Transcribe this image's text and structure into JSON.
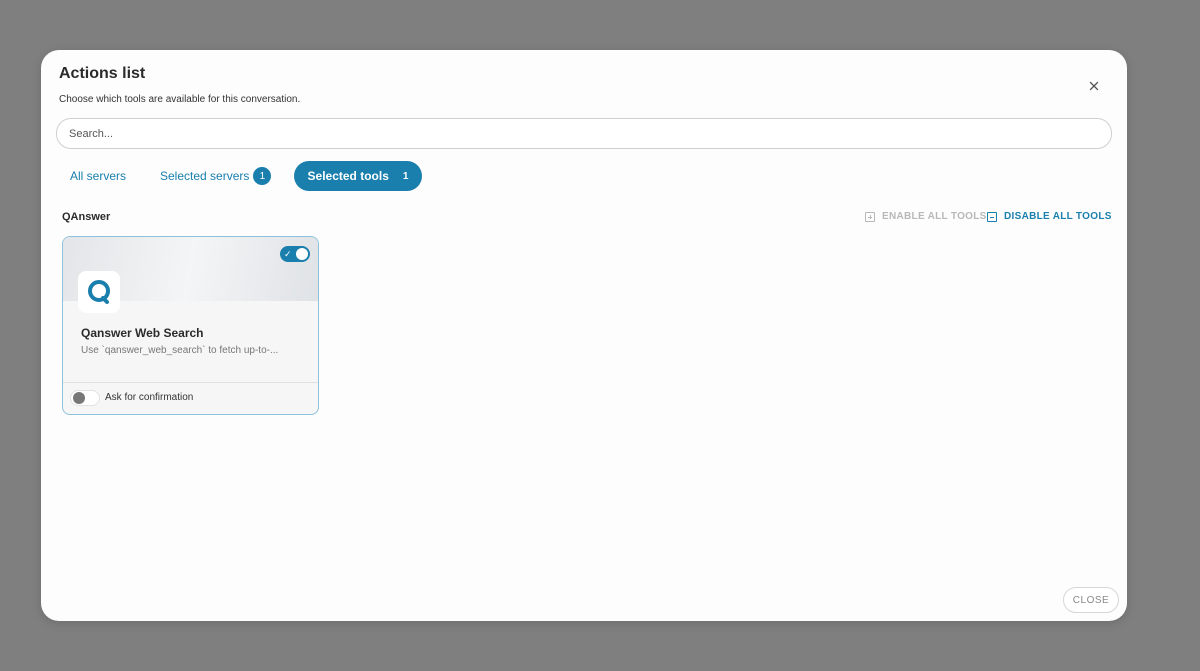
{
  "dialog": {
    "title": "Actions list",
    "subtitle": "Choose which tools are available for this conversation.",
    "close_icon": "close-icon"
  },
  "search": {
    "placeholder": "Search...",
    "value": ""
  },
  "tabs": [
    {
      "label": "All servers",
      "active": false
    },
    {
      "label": "Selected servers",
      "badge": "1",
      "active": false
    },
    {
      "label": "Selected tools",
      "badge": "1",
      "active": true
    }
  ],
  "group": {
    "name": "QAnswer",
    "enable_all_label": "ENABLE ALL TOOLS",
    "disable_all_label": "DISABLE ALL TOOLS"
  },
  "tools": [
    {
      "name": "Qanswer Web Search",
      "description": "Use `qanswer_web_search` to fetch up-to-...",
      "enabled": true,
      "ask_confirmation": false,
      "confirmation_label": "Ask for confirmation",
      "logo_icon": "qanswer-logo-icon"
    }
  ],
  "footer": {
    "close_label": "CLOSE"
  },
  "colors": {
    "accent": "#1a7fad",
    "overlay": "#7f7f7f",
    "disabled_text": "#b8b8b8"
  }
}
